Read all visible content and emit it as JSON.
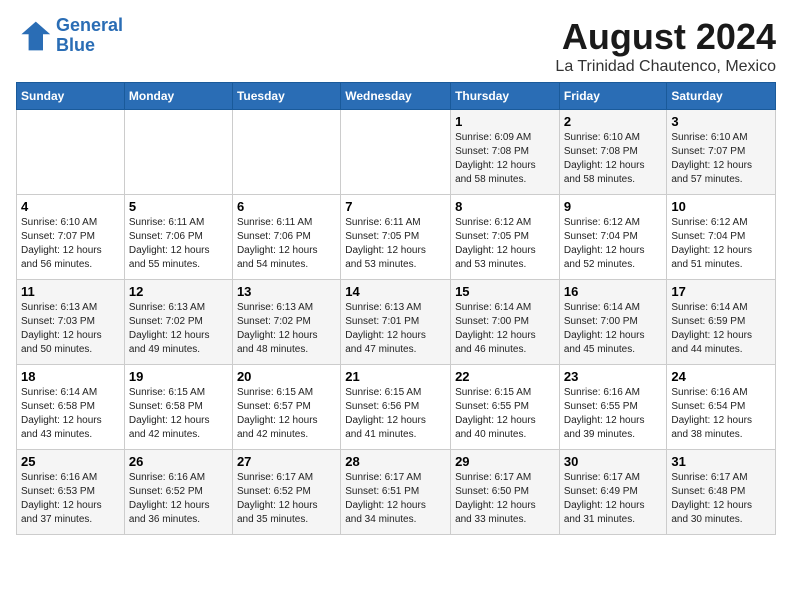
{
  "header": {
    "logo_line1": "General",
    "logo_line2": "Blue",
    "title": "August 2024",
    "subtitle": "La Trinidad Chautenco, Mexico"
  },
  "weekdays": [
    "Sunday",
    "Monday",
    "Tuesday",
    "Wednesday",
    "Thursday",
    "Friday",
    "Saturday"
  ],
  "weeks": [
    [
      {
        "day": "",
        "info": ""
      },
      {
        "day": "",
        "info": ""
      },
      {
        "day": "",
        "info": ""
      },
      {
        "day": "",
        "info": ""
      },
      {
        "day": "1",
        "info": "Sunrise: 6:09 AM\nSunset: 7:08 PM\nDaylight: 12 hours\nand 58 minutes."
      },
      {
        "day": "2",
        "info": "Sunrise: 6:10 AM\nSunset: 7:08 PM\nDaylight: 12 hours\nand 58 minutes."
      },
      {
        "day": "3",
        "info": "Sunrise: 6:10 AM\nSunset: 7:07 PM\nDaylight: 12 hours\nand 57 minutes."
      }
    ],
    [
      {
        "day": "4",
        "info": "Sunrise: 6:10 AM\nSunset: 7:07 PM\nDaylight: 12 hours\nand 56 minutes."
      },
      {
        "day": "5",
        "info": "Sunrise: 6:11 AM\nSunset: 7:06 PM\nDaylight: 12 hours\nand 55 minutes."
      },
      {
        "day": "6",
        "info": "Sunrise: 6:11 AM\nSunset: 7:06 PM\nDaylight: 12 hours\nand 54 minutes."
      },
      {
        "day": "7",
        "info": "Sunrise: 6:11 AM\nSunset: 7:05 PM\nDaylight: 12 hours\nand 53 minutes."
      },
      {
        "day": "8",
        "info": "Sunrise: 6:12 AM\nSunset: 7:05 PM\nDaylight: 12 hours\nand 53 minutes."
      },
      {
        "day": "9",
        "info": "Sunrise: 6:12 AM\nSunset: 7:04 PM\nDaylight: 12 hours\nand 52 minutes."
      },
      {
        "day": "10",
        "info": "Sunrise: 6:12 AM\nSunset: 7:04 PM\nDaylight: 12 hours\nand 51 minutes."
      }
    ],
    [
      {
        "day": "11",
        "info": "Sunrise: 6:13 AM\nSunset: 7:03 PM\nDaylight: 12 hours\nand 50 minutes."
      },
      {
        "day": "12",
        "info": "Sunrise: 6:13 AM\nSunset: 7:02 PM\nDaylight: 12 hours\nand 49 minutes."
      },
      {
        "day": "13",
        "info": "Sunrise: 6:13 AM\nSunset: 7:02 PM\nDaylight: 12 hours\nand 48 minutes."
      },
      {
        "day": "14",
        "info": "Sunrise: 6:13 AM\nSunset: 7:01 PM\nDaylight: 12 hours\nand 47 minutes."
      },
      {
        "day": "15",
        "info": "Sunrise: 6:14 AM\nSunset: 7:00 PM\nDaylight: 12 hours\nand 46 minutes."
      },
      {
        "day": "16",
        "info": "Sunrise: 6:14 AM\nSunset: 7:00 PM\nDaylight: 12 hours\nand 45 minutes."
      },
      {
        "day": "17",
        "info": "Sunrise: 6:14 AM\nSunset: 6:59 PM\nDaylight: 12 hours\nand 44 minutes."
      }
    ],
    [
      {
        "day": "18",
        "info": "Sunrise: 6:14 AM\nSunset: 6:58 PM\nDaylight: 12 hours\nand 43 minutes."
      },
      {
        "day": "19",
        "info": "Sunrise: 6:15 AM\nSunset: 6:58 PM\nDaylight: 12 hours\nand 42 minutes."
      },
      {
        "day": "20",
        "info": "Sunrise: 6:15 AM\nSunset: 6:57 PM\nDaylight: 12 hours\nand 42 minutes."
      },
      {
        "day": "21",
        "info": "Sunrise: 6:15 AM\nSunset: 6:56 PM\nDaylight: 12 hours\nand 41 minutes."
      },
      {
        "day": "22",
        "info": "Sunrise: 6:15 AM\nSunset: 6:55 PM\nDaylight: 12 hours\nand 40 minutes."
      },
      {
        "day": "23",
        "info": "Sunrise: 6:16 AM\nSunset: 6:55 PM\nDaylight: 12 hours\nand 39 minutes."
      },
      {
        "day": "24",
        "info": "Sunrise: 6:16 AM\nSunset: 6:54 PM\nDaylight: 12 hours\nand 38 minutes."
      }
    ],
    [
      {
        "day": "25",
        "info": "Sunrise: 6:16 AM\nSunset: 6:53 PM\nDaylight: 12 hours\nand 37 minutes."
      },
      {
        "day": "26",
        "info": "Sunrise: 6:16 AM\nSunset: 6:52 PM\nDaylight: 12 hours\nand 36 minutes."
      },
      {
        "day": "27",
        "info": "Sunrise: 6:17 AM\nSunset: 6:52 PM\nDaylight: 12 hours\nand 35 minutes."
      },
      {
        "day": "28",
        "info": "Sunrise: 6:17 AM\nSunset: 6:51 PM\nDaylight: 12 hours\nand 34 minutes."
      },
      {
        "day": "29",
        "info": "Sunrise: 6:17 AM\nSunset: 6:50 PM\nDaylight: 12 hours\nand 33 minutes."
      },
      {
        "day": "30",
        "info": "Sunrise: 6:17 AM\nSunset: 6:49 PM\nDaylight: 12 hours\nand 31 minutes."
      },
      {
        "day": "31",
        "info": "Sunrise: 6:17 AM\nSunset: 6:48 PM\nDaylight: 12 hours\nand 30 minutes."
      }
    ]
  ]
}
